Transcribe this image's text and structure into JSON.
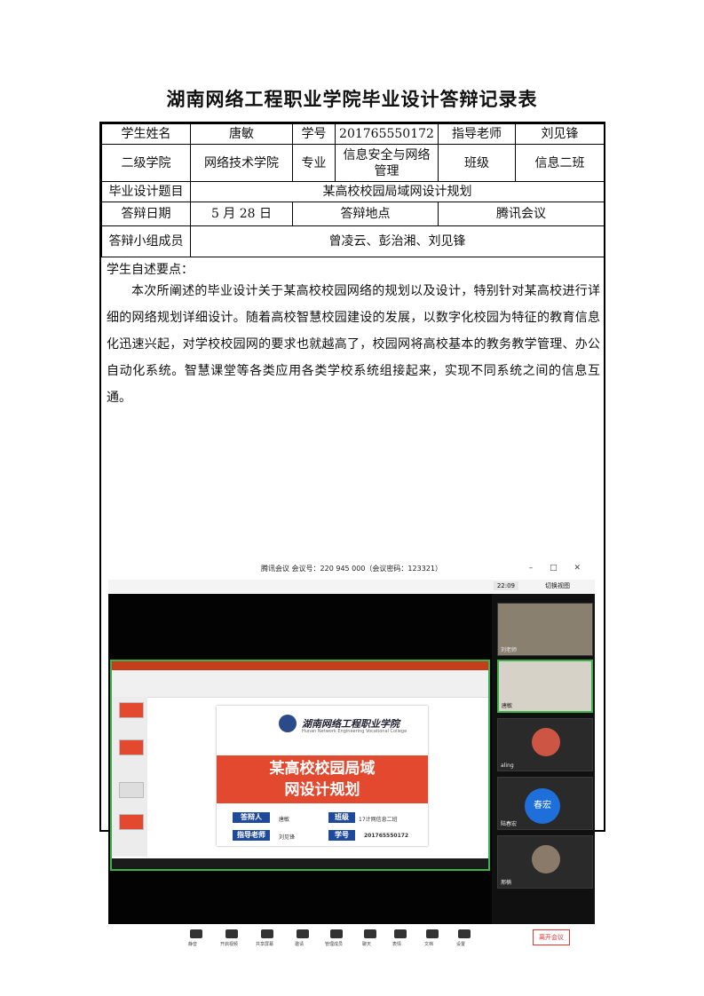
{
  "doc": {
    "title": "湖南网络工程职业学院毕业设计答辩记录表"
  },
  "table": {
    "row1": {
      "student_name_label": "学生姓名",
      "student_name": "唐敏",
      "student_id_label": "学号",
      "student_id": "201765550172",
      "advisor_label": "指导老师",
      "advisor": "刘见锋"
    },
    "row2": {
      "college_label": "二级学院",
      "college": "网络技术学院",
      "major_label": "专业",
      "major": "信息安全与网络管理",
      "class_label": "班级",
      "class": "信息二班"
    },
    "row3": {
      "topic_label": "毕业设计题目",
      "topic": "某高校校园局域网设计规划"
    },
    "row4": {
      "date_label": "答辩日期",
      "date": "5 月 28 日",
      "place_label": "答辩地点",
      "place": "腾讯会议"
    },
    "row5": {
      "panel_label": "答辩小组成员",
      "panel": "曾凌云、彭治湘、刘见锋"
    }
  },
  "self_statement": {
    "label": "学生自述要点：",
    "body": "本次所阐述的毕业设计关于某高校校园网络的规划以及设计，特别针对某高校进行详细的网络规划详细设计。随着高校智慧校园建设的发展，以数字化校园为特征的教育信息化迅速兴起，对学校校园网的要求也就越高了，校园网将高校基本的教务教学管理、办公自动化系统。智慧课堂等各类应用各类学校系统组接起来，实现不同系统之间的信息互通。"
  },
  "screenshot": {
    "window_title": "腾讯会议 会议号：220 945 000（会议密码：123321）",
    "clock": "22:09",
    "switch_view": "切换视图",
    "participants": [
      "刘老师",
      "唐敏",
      "aling",
      "陆春宏",
      "邢楠"
    ],
    "avatar_text": "春宏",
    "slide": {
      "school_name": "湖南网络工程职业学院",
      "school_en": "Hunan Network Engineering Vocational College",
      "title_line1": "某高校校园局域",
      "title_line2": "网设计规划",
      "defender_label": "答辩人",
      "defender": "唐敏",
      "class_label": "班级",
      "class": "17计网信息二班",
      "advisor_label": "指导老师",
      "advisor": "刘见锋",
      "id_label": "学号",
      "id": "201765550172"
    },
    "toolbar": [
      "静音",
      "开启视频",
      "共享屏幕",
      "邀请",
      "管理成员",
      "聊天",
      "表情",
      "文档",
      "设置"
    ],
    "leave_label": "离开会议"
  }
}
